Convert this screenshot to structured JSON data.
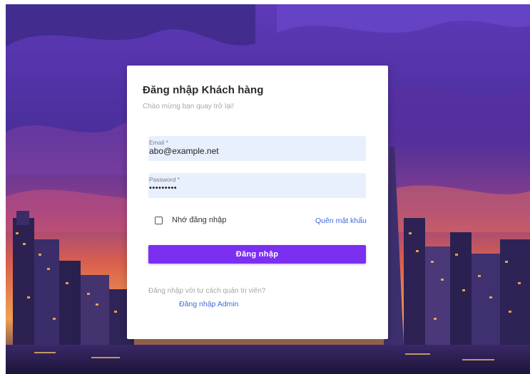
{
  "login": {
    "title": "Đăng nhập Khách hàng",
    "subtitle": "Chào mừng bạn quay trở lại!",
    "email": {
      "label": "Email *",
      "value": "abo@example.net"
    },
    "password": {
      "label": "Password *",
      "value": "•••••••••"
    },
    "remember_label": "Nhớ đăng nhập",
    "remember_checked": false,
    "forgot_label": "Quên mật khẩu",
    "submit_label": "Đăng nhập",
    "admin_question": "Đăng nhập với tư cách quản trị viên?",
    "admin_link": "Đăng nhập Admin"
  },
  "colors": {
    "accent": "#7b2ff0",
    "link": "#3f6ad8",
    "field_bg": "#e8f0fe"
  }
}
